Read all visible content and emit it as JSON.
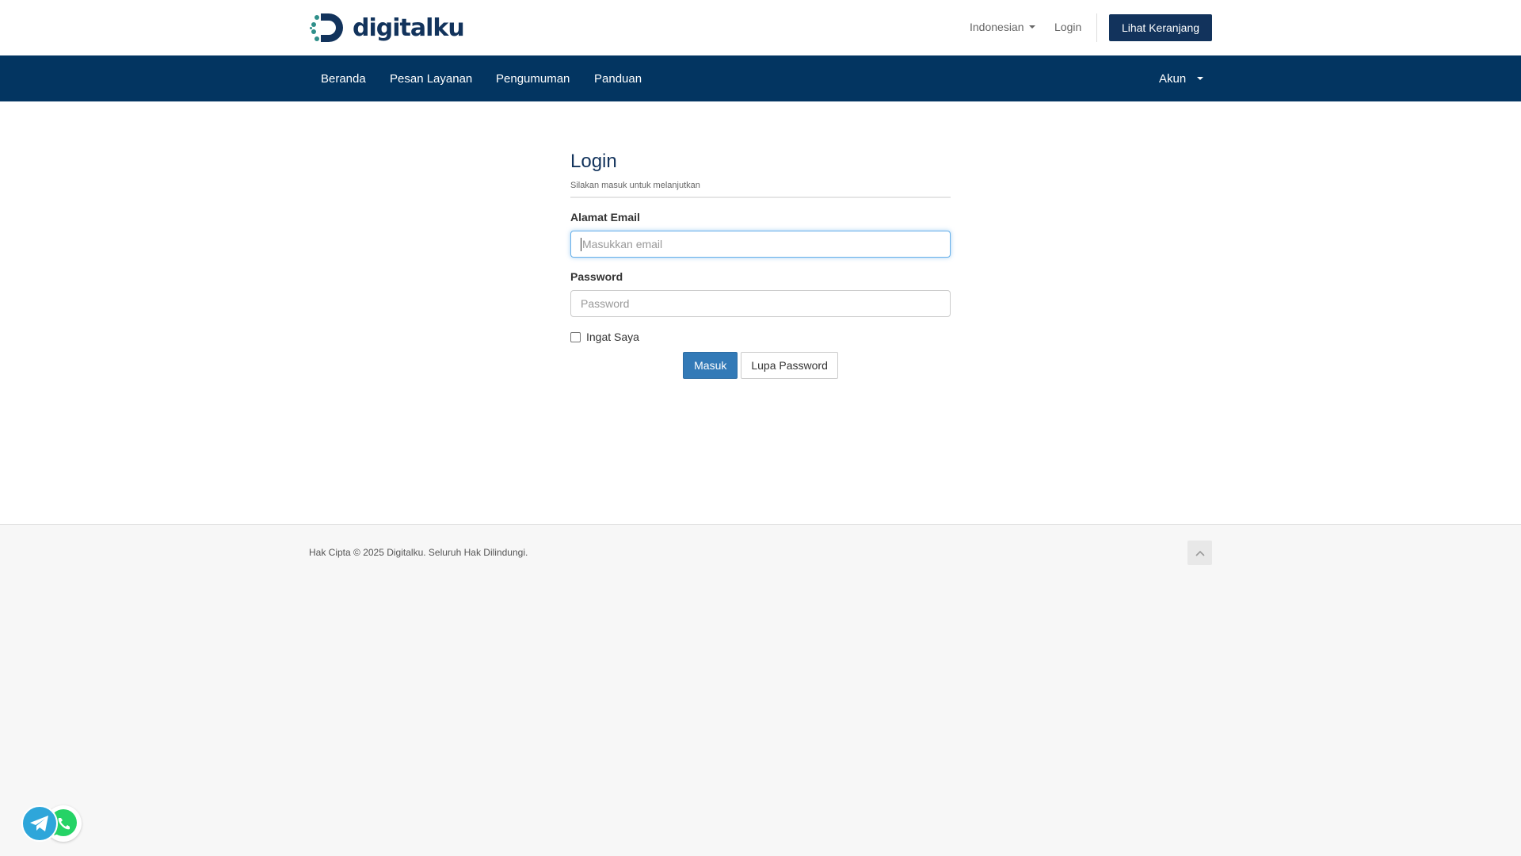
{
  "header": {
    "logo_text": "digitalku",
    "language": "Indonesian",
    "login": "Login",
    "cart_button": "Lihat Keranjang"
  },
  "nav": {
    "items": [
      {
        "label": "Beranda"
      },
      {
        "label": "Pesan Layanan"
      },
      {
        "label": "Pengumuman"
      },
      {
        "label": "Panduan"
      }
    ],
    "account": "Akun"
  },
  "login_form": {
    "title": "Login",
    "subtitle": "Silakan masuk untuk melanjutkan",
    "email_label": "Alamat Email",
    "email_placeholder": "Masukkan email",
    "password_label": "Password",
    "password_placeholder": "Password",
    "remember_label": "Ingat Saya",
    "submit_button": "Masuk",
    "forgot_button": "Lupa Password"
  },
  "footer": {
    "copyright": "Hak Cipta © 2025 Digitalku. Seluruh Hak Dilindungi."
  },
  "colors": {
    "brand": "#12335c",
    "nav_bg": "#033561",
    "primary": "#337ab7",
    "telegram": "#2ea6da",
    "whatsapp": "#25d366"
  },
  "icons": {
    "back_to_top": "chevron-up-icon",
    "telegram": "telegram-icon",
    "whatsapp": "whatsapp-icon"
  }
}
